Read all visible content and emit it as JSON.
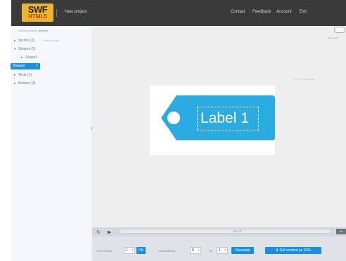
{
  "header": {
    "logo_top": "SWF",
    "logo_bottom": "HTML5",
    "project_title": "New project",
    "nav": [
      "Contact",
      "Feedback",
      "Account",
      "Exit"
    ]
  },
  "sidebar": {
    "breadcrumb_prefix": "Current project:",
    "breadcrumb_file": "test.swf",
    "tree": [
      {
        "label": "Sprites (3)",
        "caret": "▸"
      },
      {
        "label": "Shapes (2)",
        "caret": "▾"
      },
      {
        "label": "Shape1",
        "caret": "▸"
      },
      {
        "label": "Texts (1)",
        "caret": "▸"
      },
      {
        "label": "Buttons (4)",
        "caret": "▸"
      }
    ],
    "selected": {
      "label": "Shape2",
      "close": "×"
    },
    "selected_hint": "Select shape"
  },
  "stage": {
    "collapse_icon": "‹",
    "screenshot_label": "Screenshot",
    "hint": "Click to edit properties",
    "tag_label": "Label 1",
    "colors": {
      "tag": "#2aabe2",
      "accent": "#1c8ee0"
    }
  },
  "timeline": {
    "reset_icon": "↻",
    "play_icon": "▶",
    "mid_label": "frame 1/1",
    "end_label": "1s"
  },
  "bottom": {
    "go_to_label": "Go to frame",
    "go_to_value": "1",
    "ok_label": "OK",
    "from_label": "Convert from",
    "from_value": "0",
    "to_label": "To",
    "to_value": "1",
    "generate_label": "Generate",
    "download_label": "Get content as SVG",
    "download_icon": "⬇"
  }
}
